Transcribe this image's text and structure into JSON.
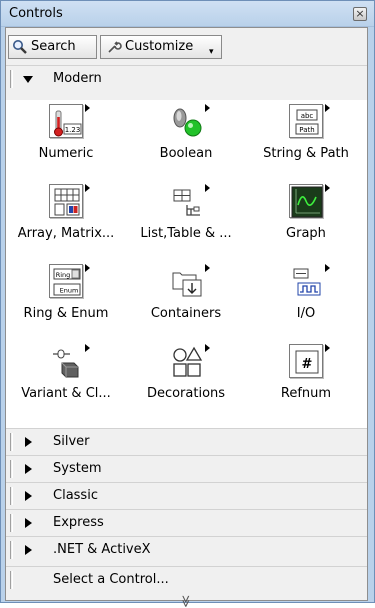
{
  "window": {
    "title": "Controls",
    "close_glyph": "×"
  },
  "toolbar": {
    "search_label": "Search",
    "customize_label": "Customize",
    "customize_caret": "▾"
  },
  "palette": {
    "open_section": "Modern",
    "items": [
      {
        "label": "Numeric",
        "icon": "numeric-icon"
      },
      {
        "label": "Boolean",
        "icon": "boolean-icon"
      },
      {
        "label": "String & Path",
        "icon": "string-path-icon"
      },
      {
        "label": "Array, Matrix...",
        "icon": "array-matrix-icon"
      },
      {
        "label": "List,Table & ...",
        "icon": "list-table-icon"
      },
      {
        "label": "Graph",
        "icon": "graph-icon"
      },
      {
        "label": "Ring & Enum",
        "icon": "ring-enum-icon"
      },
      {
        "label": "Containers",
        "icon": "containers-icon"
      },
      {
        "label": "I/O",
        "icon": "io-icon"
      },
      {
        "label": "Variant & Cl...",
        "icon": "variant-class-icon"
      },
      {
        "label": "Decorations",
        "icon": "decorations-icon"
      },
      {
        "label": "Refnum",
        "icon": "refnum-icon"
      }
    ],
    "icon_text": {
      "numeric": "1.23",
      "abc": "abc",
      "path": "Path",
      "ring": "Ring",
      "enum": "Enum",
      "refnum": "#"
    },
    "collapsed_sections": [
      "Silver",
      "System",
      "Classic",
      "Express",
      ".NET & ActiveX"
    ],
    "select_control": "Select a Control...",
    "more_chevron": "≫"
  },
  "colors": {
    "window_frame": "#b9d1ea",
    "panel_bg": "#f0f0f0",
    "grid_bg": "#ffffff",
    "led_green": "#22c22a",
    "graph_screen": "#1a3b1a"
  }
}
